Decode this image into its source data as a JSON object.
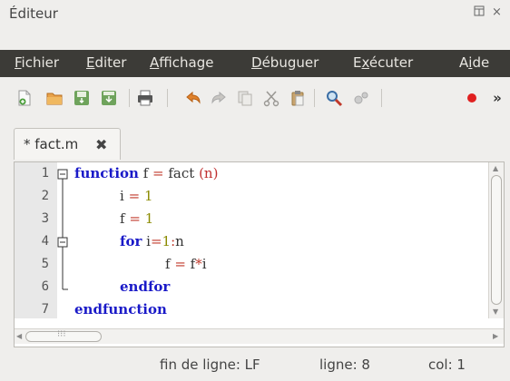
{
  "window": {
    "title": "Éditeur",
    "float_icon": "float-window-icon",
    "close_icon": "close-icon"
  },
  "menubar": {
    "items": [
      {
        "label": "Fichier",
        "mnemonic": "F"
      },
      {
        "label": "Editer",
        "mnemonic": "E"
      },
      {
        "label": "Affichage",
        "mnemonic": "A"
      },
      {
        "label": "Débuguer",
        "mnemonic": "D"
      },
      {
        "label": "Exécuter",
        "mnemonic": "x"
      },
      {
        "label": "Aide",
        "mnemonic": "i"
      }
    ]
  },
  "toolbar": {
    "icons": [
      "new-file-icon",
      "open-folder-icon",
      "save-icon",
      "save-as-icon",
      "print-icon",
      "undo-icon",
      "redo-icon",
      "copy-icon",
      "cut-icon",
      "paste-icon",
      "find-icon",
      "settings-icon",
      "breakpoint-icon",
      "more-icon"
    ],
    "overflow": "»"
  },
  "tabs": [
    {
      "label": "* fact.m",
      "close_icon": "close-tab-icon",
      "close_glyph": "✖"
    }
  ],
  "editor": {
    "lines": [
      {
        "num": "1",
        "fold": "box"
      },
      {
        "num": "2",
        "fold": "line"
      },
      {
        "num": "3",
        "fold": "line"
      },
      {
        "num": "4",
        "fold": "box"
      },
      {
        "num": "5",
        "fold": "line"
      },
      {
        "num": "6",
        "fold": "end"
      },
      {
        "num": "7",
        "fold": "none"
      }
    ],
    "code": {
      "l1_kw": "function",
      "l1_rest": " f ",
      "l1_eq": "=",
      "l1_fn": " fact ",
      "l1_args": "(n)",
      "l2_var": "i ",
      "l2_eq": "=",
      "l2_val": "1",
      "l3_var": "f ",
      "l3_eq": "=",
      "l3_val": "1",
      "l4_kw": "for",
      "l4_a": " i",
      "l4_eq": "=",
      "l4_one": "1",
      "l4_colon": ":",
      "l4_n": "n",
      "l5_a": "f ",
      "l5_eq": "=",
      "l5_b": " f",
      "l5_mul": "*",
      "l5_c": "i",
      "l6_kw": "endfor",
      "l7_kw": "endfunction"
    },
    "hscroll_grip": "⁝⁝⁝"
  },
  "statusbar": {
    "eol": "fin de ligne: LF",
    "line": "ligne: 8",
    "col": "col: 1"
  },
  "colors": {
    "menubar_bg": "#3c3b37",
    "keyword": "#1a1ac8",
    "number": "#8b8b00",
    "operator": "#c0392b"
  }
}
